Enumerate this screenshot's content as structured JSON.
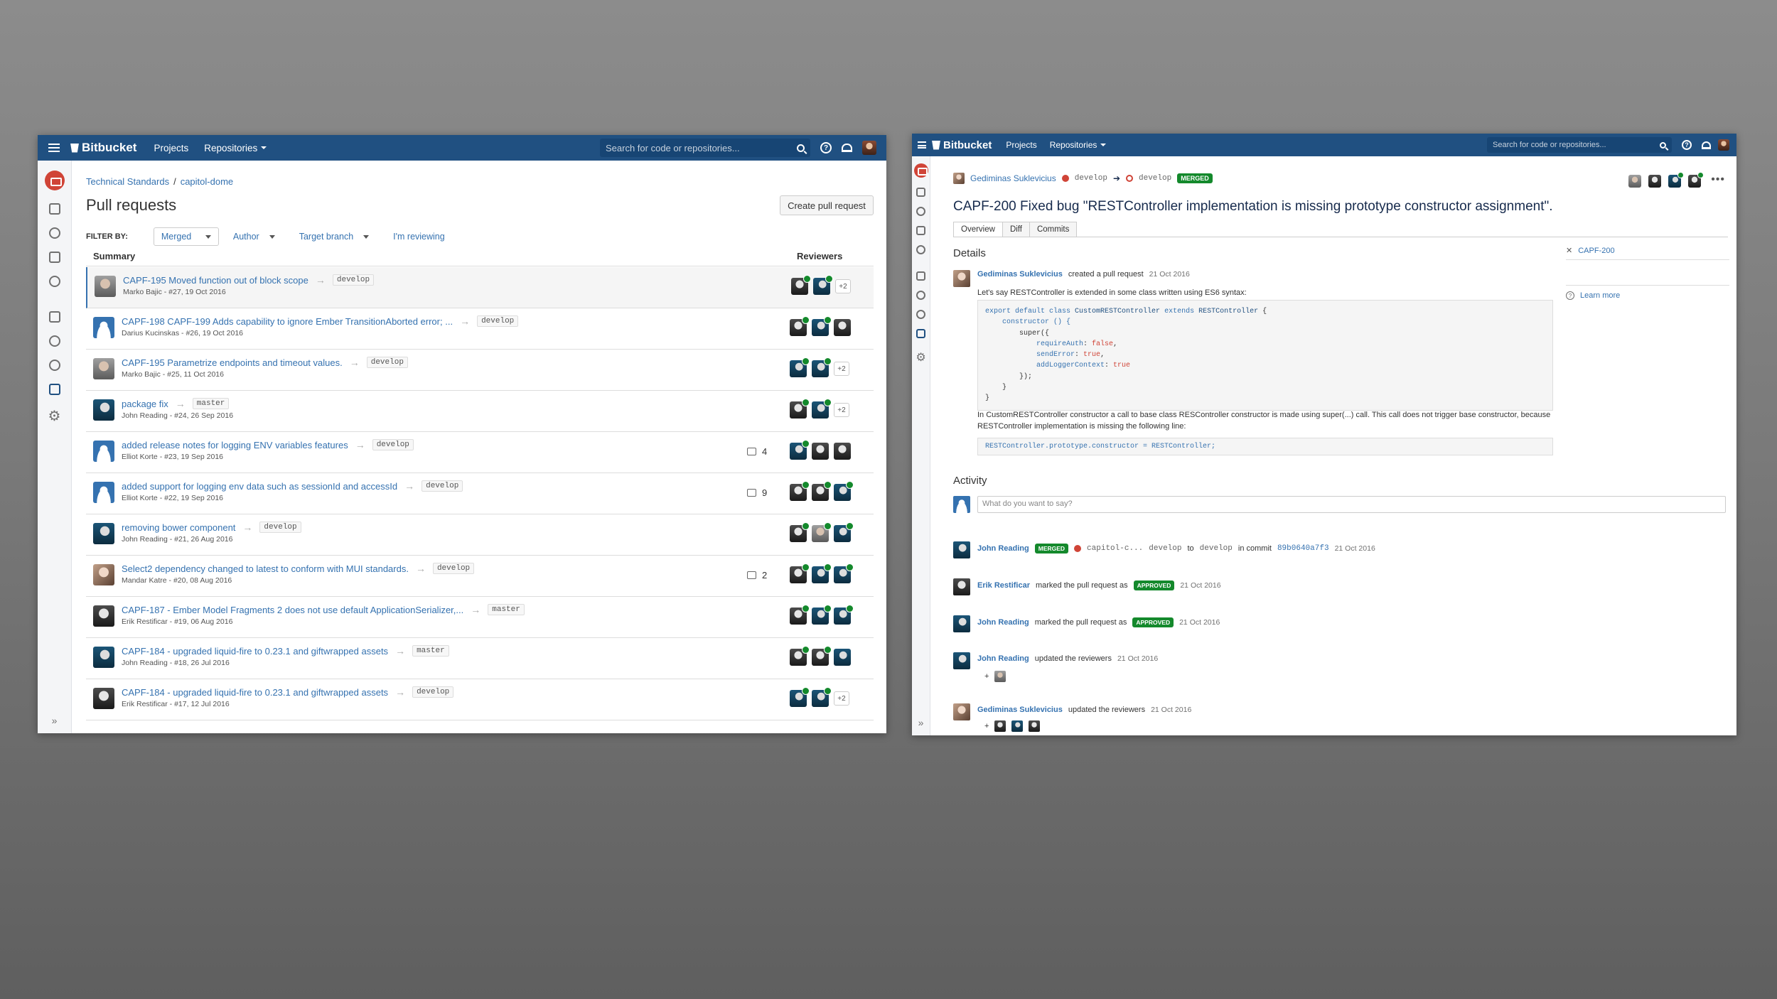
{
  "left_window": {
    "topbar": {
      "logo": "Bitbucket",
      "nav": [
        "Projects",
        "Repositories"
      ],
      "search_placeholder": "Search for code or repositories..."
    },
    "breadcrumb": {
      "project": "Technical Standards",
      "separator": "/",
      "repo": "capitol-dome"
    },
    "page_title": "Pull requests",
    "create_button": "Create pull request",
    "filters": {
      "label": "FILTER BY:",
      "state": "Merged",
      "author": "Author",
      "target_branch": "Target branch",
      "reviewing": "I'm reviewing"
    },
    "columns": {
      "summary": "Summary",
      "reviewers": "Reviewers"
    },
    "rows": [
      {
        "title": "CAPF-195 Moved function out of block scope",
        "branch": "develop",
        "meta": "Marko Bajic - #27, 19 Oct 2016",
        "comments": "",
        "extra": "+2"
      },
      {
        "title": "CAPF-198 CAPF-199 Adds capability to ignore Ember TransitionAborted error; ...",
        "branch": "develop",
        "meta": "Darius Kucinskas - #26, 19 Oct 2016",
        "comments": "",
        "extra": ""
      },
      {
        "title": "CAPF-195 Parametrize endpoints and timeout values.",
        "branch": "develop",
        "meta": "Marko Bajic - #25, 11 Oct 2016",
        "comments": "",
        "extra": "+2"
      },
      {
        "title": "package fix",
        "branch": "master",
        "meta": "John Reading - #24, 26 Sep 2016",
        "comments": "",
        "extra": "+2"
      },
      {
        "title": "added release notes for logging ENV variables features",
        "branch": "develop",
        "meta": "Elliot Korte - #23, 19 Sep 2016",
        "comments": "4",
        "extra": ""
      },
      {
        "title": "added support for logging env data such as sessionId and accessId",
        "branch": "develop",
        "meta": "Elliot Korte - #22, 19 Sep 2016",
        "comments": "9",
        "extra": ""
      },
      {
        "title": "removing bower component",
        "branch": "develop",
        "meta": "John Reading - #21, 26 Aug 2016",
        "comments": "",
        "extra": ""
      },
      {
        "title": "Select2 dependency changed to latest to conform with MUI standards.",
        "branch": "develop",
        "meta": "Mandar Katre - #20, 08 Aug 2016",
        "comments": "2",
        "extra": ""
      },
      {
        "title": "CAPF-187 - Ember Model Fragments 2 does not use default ApplicationSerializer,...",
        "branch": "master",
        "meta": "Erik Restificar - #19, 06 Aug 2016",
        "comments": "",
        "extra": ""
      },
      {
        "title": "CAPF-184 - upgraded liquid-fire to 0.23.1 and giftwrapped assets",
        "branch": "master",
        "meta": "John Reading - #18, 26 Jul 2016",
        "comments": "",
        "extra": ""
      },
      {
        "title": "CAPF-184 - upgraded liquid-fire to 0.23.1 and giftwrapped assets",
        "branch": "develop",
        "meta": "Erik Restificar - #17, 12 Jul 2016",
        "comments": "",
        "extra": "+2"
      }
    ]
  },
  "right_window": {
    "topbar": {
      "logo": "Bitbucket",
      "nav": [
        "Projects",
        "Repositories"
      ],
      "search_placeholder": "Search for code or repositories..."
    },
    "header": {
      "author": "Gediminas Suklevicius",
      "source_branch": "develop",
      "target_branch": "develop",
      "status": "MERGED"
    },
    "title": "CAPF-200 Fixed bug \"RESTController implementation is missing prototype constructor assignment\".",
    "tabs": [
      "Overview",
      "Diff",
      "Commits"
    ],
    "details_heading": "Details",
    "created": {
      "author": "Gediminas Suklevicius",
      "action": "created a pull request",
      "date": "21 Oct 2016"
    },
    "description_1": "Let's say RESTController is extended in some class written using ES6 syntax:",
    "code_lines": {
      "l1a": "export default class ",
      "l1b": "CustomRESTController",
      "l1c": " extends ",
      "l1d": "RESTController",
      "l1e": " {",
      "l2": "    constructor () {",
      "l3": "        super({",
      "l4a": "            requireAuth",
      "l4b": ": ",
      "l4c": "false",
      "l4d": ",",
      "l5a": "            sendError",
      "l5b": ": ",
      "l5c": "true",
      "l5d": ",",
      "l6a": "            addLoggerContext",
      "l6b": ": ",
      "l6c": "true",
      "l7": "        });",
      "l8": "    }",
      "l9": "}"
    },
    "description_2": "In CustomRESTController constructor a call to base class RESController constructor is made using super(...) call. This call does not trigger base constructor, because RESTController implementation is missing the following line:",
    "code_2": "RESTController.prototype.constructor = RESTController;",
    "side_panel": {
      "issue": "CAPF-200",
      "learn_more": "Learn more"
    },
    "activity_heading": "Activity",
    "comment_placeholder": "What do you want to say?",
    "activity": {
      "merged": {
        "user": "John Reading",
        "badge": "MERGED",
        "repo": "capitol-c...",
        "from": "develop",
        "to_word": "to",
        "to": "develop",
        "in_commit": "in commit",
        "commit": "89b0640a7f3",
        "date": "21 Oct 2016"
      },
      "approved_1": {
        "user": "Erik Restificar",
        "action": "marked the pull request as",
        "badge": "APPROVED",
        "date": "21 Oct 2016"
      },
      "approved_2": {
        "user": "John Reading",
        "action": "marked the pull request as",
        "badge": "APPROVED",
        "date": "21 Oct 2016"
      },
      "reviewers_1": {
        "user": "John Reading",
        "action": "updated the reviewers",
        "date": "21 Oct 2016",
        "plus": "+"
      },
      "reviewers_2": {
        "user": "Gediminas Suklevicius",
        "action": "updated the reviewers",
        "date": "21 Oct 2016",
        "plus": "+"
      }
    }
  },
  "colors": {
    "topbar": "#205081",
    "link": "#3572b0",
    "approved": "#14892c",
    "repo_icon": "#d04437"
  },
  "icons": [
    "menu-icon",
    "bitbucket-logo-icon",
    "search-icon",
    "help-icon",
    "notifications-icon",
    "repo-icon",
    "clone-icon",
    "branch-icon",
    "pull-request-icon",
    "settings-icon",
    "expand-icon",
    "comment-icon",
    "approved-check-icon"
  ]
}
